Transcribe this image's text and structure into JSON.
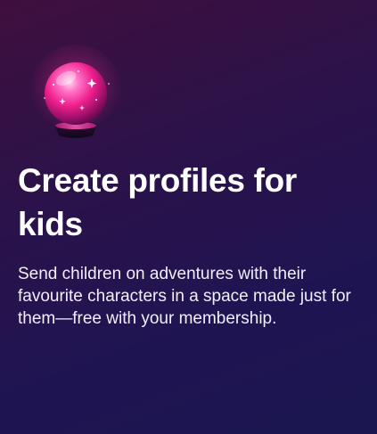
{
  "card": {
    "icon": "crystal-ball-icon",
    "title": "Create profiles for kids",
    "description": "Send children on adventures with their favourite characters in a space made just for them—free with your membership."
  },
  "colors": {
    "background_top": "#3f0f3e",
    "background_bottom": "#1b1650",
    "orb": "#ff3d9a",
    "text": "#ffffff"
  }
}
